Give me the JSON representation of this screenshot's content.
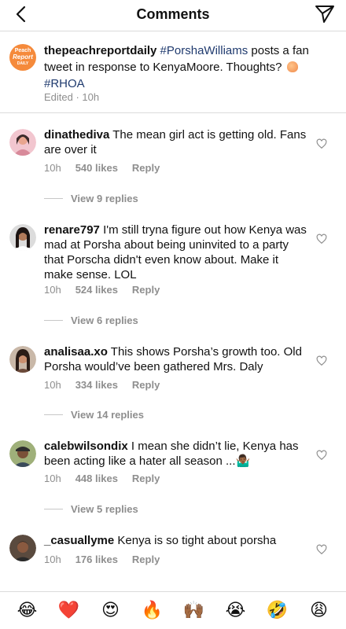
{
  "header": {
    "title": "Comments"
  },
  "caption": {
    "user": "thepeachreportdaily",
    "tag1": "#PorshaWilliams",
    "text": " posts a fan tweet in response to KenyaMoore. Thoughts?",
    "tag2": "#RHOA",
    "meta": "Edited · 10h",
    "avatar": {
      "line1": "Peach",
      "line2": "Report",
      "line3": "DAILY"
    }
  },
  "comments": [
    {
      "user": "dinathediva",
      "text": "The mean girl act is getting old. Fans are over it",
      "time": "10h",
      "likes": "540 likes",
      "reply": "Reply",
      "replies": "View 9 replies"
    },
    {
      "user": "renare797",
      "text": "I'm still tryna figure out how Kenya was mad at Porsha about being uninvited to a party that Porscha didn't even know about. Make it make sense. LOL",
      "time": "10h",
      "likes": "524 likes",
      "reply": "Reply",
      "replies": "View 6 replies"
    },
    {
      "user": "analisaa.xo",
      "text": "This shows Porsha’s growth too. Old Porsha would’ve been gathered Mrs. Daly",
      "time": "10h",
      "likes": "334 likes",
      "reply": "Reply",
      "replies": "View 14 replies"
    },
    {
      "user": "calebwilsondix",
      "text": "I mean she didn’t lie, Kenya has been acting like a hater all season ...🤷🏾‍♂️",
      "time": "10h",
      "likes": "448 likes",
      "reply": "Reply",
      "replies": "View 5 replies"
    },
    {
      "user": "_casuallyme",
      "text": "Kenya is so tight about porsha",
      "time": "10h",
      "likes": "176 likes",
      "reply": "Reply"
    }
  ],
  "emoji_bar": [
    "😂",
    "❤️",
    "😍",
    "🔥",
    "🙌🏾",
    "😭",
    "🤣",
    "😩"
  ],
  "colors": {
    "hashtag": "#1f3a6e",
    "meta": "#8e8e8e",
    "brand_avatar": "#f58a3b"
  }
}
